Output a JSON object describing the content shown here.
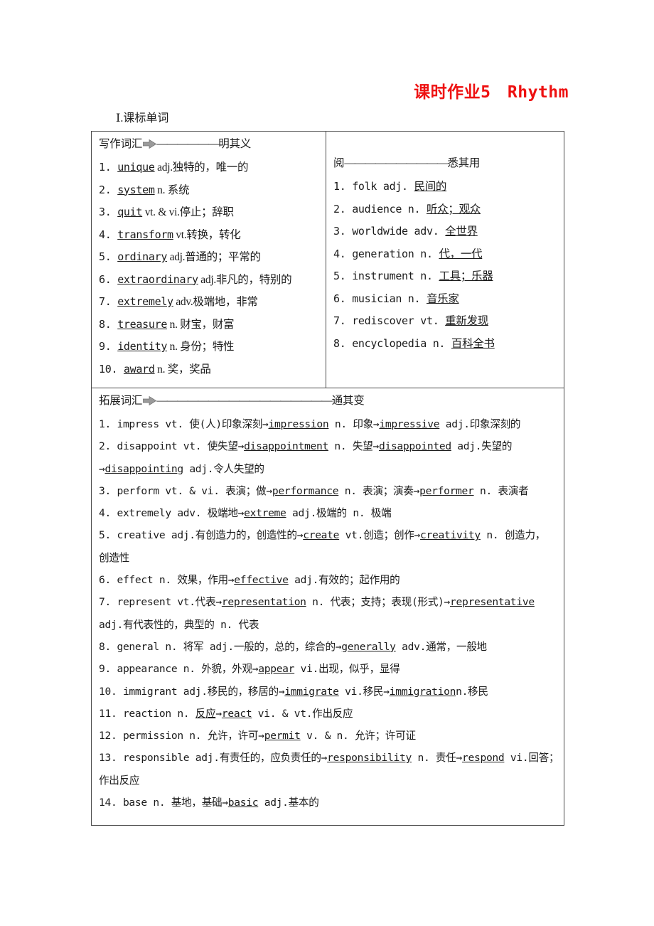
{
  "document": {
    "title": "课时作业5　Rhythm",
    "section_label": "Ⅰ.课标单词",
    "title_color": "#ee1111"
  },
  "table": {
    "writing_vocab": {
      "header_label": "写作词汇",
      "header_icon": "right-arrow-icon",
      "header_dashes": "——————",
      "header_tail": "明其义",
      "items": [
        {
          "num": "1.",
          "word": "unique",
          "rest": " adj.独特的，唯一的"
        },
        {
          "num": "2.",
          "word": "system",
          "rest": " n. 系统"
        },
        {
          "num": "3.",
          "word": "quit",
          "rest": " vt. & vi.停止；辞职"
        },
        {
          "num": "4.",
          "word": "transform",
          "rest": " vt.转换，转化"
        },
        {
          "num": "5.",
          "word": "ordinary",
          "rest": " adj.普通的；平常的"
        },
        {
          "num": "6.",
          "word": "extraordinary",
          "rest": " adj.非凡的，特别的"
        },
        {
          "num": "7.",
          "word": "extremely",
          "rest": " adv.极端地，非常"
        },
        {
          "num": "8.",
          "word": "treasure",
          "rest": " n. 财宝，财富"
        },
        {
          "num": "9.",
          "word": "identity",
          "rest": " n. 身份；特性"
        },
        {
          "num": "10.",
          "word": "award",
          "rest": " n. 奖，奖品"
        }
      ]
    },
    "reading_vocab": {
      "header_label": "阅",
      "header_dashes": "——————————",
      "header_tail": "悉其用",
      "items": [
        {
          "num": "1.",
          "lead": "folk adj. ",
          "meaning": "民间的"
        },
        {
          "num": "2.",
          "lead": "audience n. ",
          "meaning": "听众；观众"
        },
        {
          "num": "3.",
          "lead": "worldwide adv. ",
          "meaning": "全世界"
        },
        {
          "num": "4.",
          "lead": "generation n. ",
          "meaning": "代，一代"
        },
        {
          "num": "5.",
          "lead": "instrument n. ",
          "meaning": "工具；乐器"
        },
        {
          "num": "6.",
          "lead": "musician n. ",
          "meaning": "音乐家"
        },
        {
          "num": "7.",
          "lead": "rediscover vt. ",
          "meaning": "重新发现"
        },
        {
          "num": "8.",
          "lead": "encyclopedia n. ",
          "meaning": "百科全书"
        }
      ]
    },
    "extended_vocab": {
      "header_label": "拓展词汇",
      "header_icon": "right-arrow-icon",
      "header_dashes": "—————————————————",
      "header_tail": "通其变",
      "lines": [
        [
          {
            "t": "1. impress vt. 使(人)印象深刻→",
            "u": false
          },
          {
            "t": "impression",
            "u": true
          },
          {
            "t": " n. 印象→",
            "u": false
          },
          {
            "t": "impressive",
            "u": true
          },
          {
            "t": " adj.印象深刻的",
            "u": false
          }
        ],
        [
          {
            "t": "2. disappoint vt. 使失望→",
            "u": false
          },
          {
            "t": "disappointment",
            "u": true
          },
          {
            "t": " n. 失望→",
            "u": false
          },
          {
            "t": "disappointed",
            "u": true
          },
          {
            "t": " adj.失望的",
            "u": false
          }
        ],
        [
          {
            "t": "→",
            "u": false
          },
          {
            "t": "disappointing",
            "u": true
          },
          {
            "t": " adj.令人失望的",
            "u": false
          }
        ],
        [
          {
            "t": "3. perform vt. & vi. 表演；做→",
            "u": false
          },
          {
            "t": "performance",
            "u": true
          },
          {
            "t": " n. 表演；演奏→",
            "u": false
          },
          {
            "t": "performer",
            "u": true
          },
          {
            "t": " n. 表演者",
            "u": false
          }
        ],
        [
          {
            "t": "4. extremely adv. 极端地→",
            "u": false
          },
          {
            "t": "extreme",
            "u": true
          },
          {
            "t": " adj.极端的 n. 极端",
            "u": false
          }
        ],
        [
          {
            "t": "5. creative adj.有创造力的，创造性的→",
            "u": false
          },
          {
            "t": "create",
            "u": true
          },
          {
            "t": " vt.创造；创作→",
            "u": false
          },
          {
            "t": "creativity",
            "u": true
          },
          {
            "t": " n. 创造力，",
            "u": false
          }
        ],
        [
          {
            "t": "创造性",
            "u": false
          }
        ],
        [
          {
            "t": "6. effect n. 效果，作用→",
            "u": false
          },
          {
            "t": "effective",
            "u": true
          },
          {
            "t": " adj.有效的；起作用的",
            "u": false
          }
        ],
        [
          {
            "t": "7. represent vt.代表→",
            "u": false
          },
          {
            "t": "representation",
            "u": true
          },
          {
            "t": " n. 代表；支持；表现(形式)→",
            "u": false
          },
          {
            "t": "representative",
            "u": true
          }
        ],
        [
          {
            "t": "adj.有代表性的，典型的 n. 代表",
            "u": false
          }
        ],
        [
          {
            "t": "8. general n. 将军 adj.一般的，总的，综合的→",
            "u": false
          },
          {
            "t": "generally",
            "u": true
          },
          {
            "t": " adv.通常，一般地",
            "u": false
          }
        ],
        [
          {
            "t": "9. appearance n. 外貌，外观→",
            "u": false
          },
          {
            "t": "appear",
            "u": true
          },
          {
            "t": " vi.出现，似乎，显得",
            "u": false
          }
        ],
        [
          {
            "t": "10. immigrant adj.移民的，移居的→",
            "u": false
          },
          {
            "t": "immigrate",
            "u": true
          },
          {
            "t": " vi.移民→",
            "u": false
          },
          {
            "t": "immigration",
            "u": true
          },
          {
            "t": "n.移民",
            "u": false
          }
        ],
        [
          {
            "t": "11. reaction n. ",
            "u": false
          },
          {
            "t": "反应",
            "u": true
          },
          {
            "t": "→",
            "u": false
          },
          {
            "t": "react",
            "u": true
          },
          {
            "t": " vi. & vt.作出反应",
            "u": false
          }
        ],
        [
          {
            "t": "12. permission n. 允许，许可→",
            "u": false
          },
          {
            "t": "permit",
            "u": true
          },
          {
            "t": " v. & n. 允许；许可证",
            "u": false
          }
        ],
        [
          {
            "t": "13. responsible adj.有责任的，应负责任的→",
            "u": false
          },
          {
            "t": "responsibility",
            "u": true
          },
          {
            "t": " n. 责任→",
            "u": false
          },
          {
            "t": "respond",
            "u": true
          },
          {
            "t": " vi.回答；",
            "u": false
          }
        ],
        [
          {
            "t": "作出反应",
            "u": false
          }
        ],
        [
          {
            "t": "14. base n. 基地，基础→",
            "u": false
          },
          {
            "t": "basic",
            "u": true
          },
          {
            "t": " adj.基本的",
            "u": false
          }
        ]
      ]
    }
  }
}
